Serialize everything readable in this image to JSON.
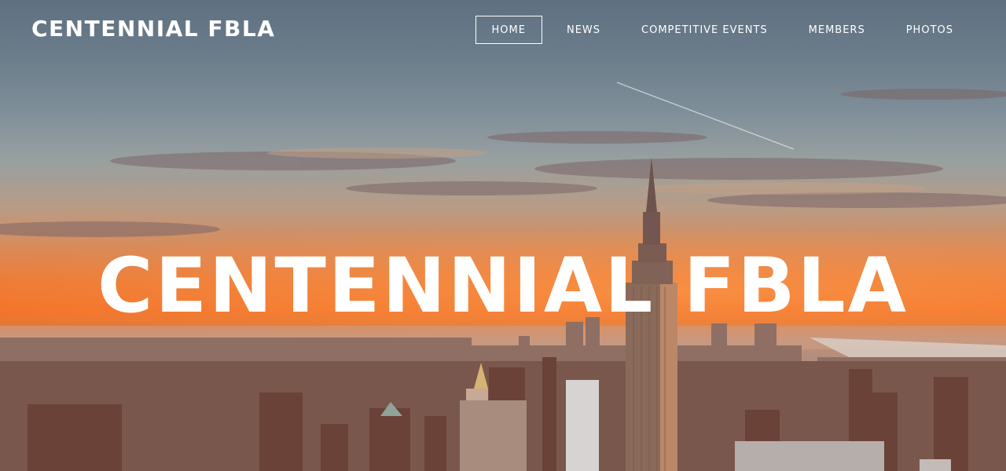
{
  "site": {
    "brand": "CENTENNIAL FBLA",
    "nav": [
      {
        "label": "HOME",
        "active": true
      },
      {
        "label": "NEWS",
        "active": false
      },
      {
        "label": "COMPETITIVE EVENTS",
        "active": false
      },
      {
        "label": "MEMBERS",
        "active": false
      },
      {
        "label": "PHOTOS",
        "active": false
      }
    ]
  },
  "hero": {
    "headline": "CENTENNIAL FBLA",
    "background": "city-skyline-sunset-photo"
  },
  "colors": {
    "text": "#ffffff",
    "sunset": "#f3742a",
    "sky": "#6b7d8b"
  }
}
